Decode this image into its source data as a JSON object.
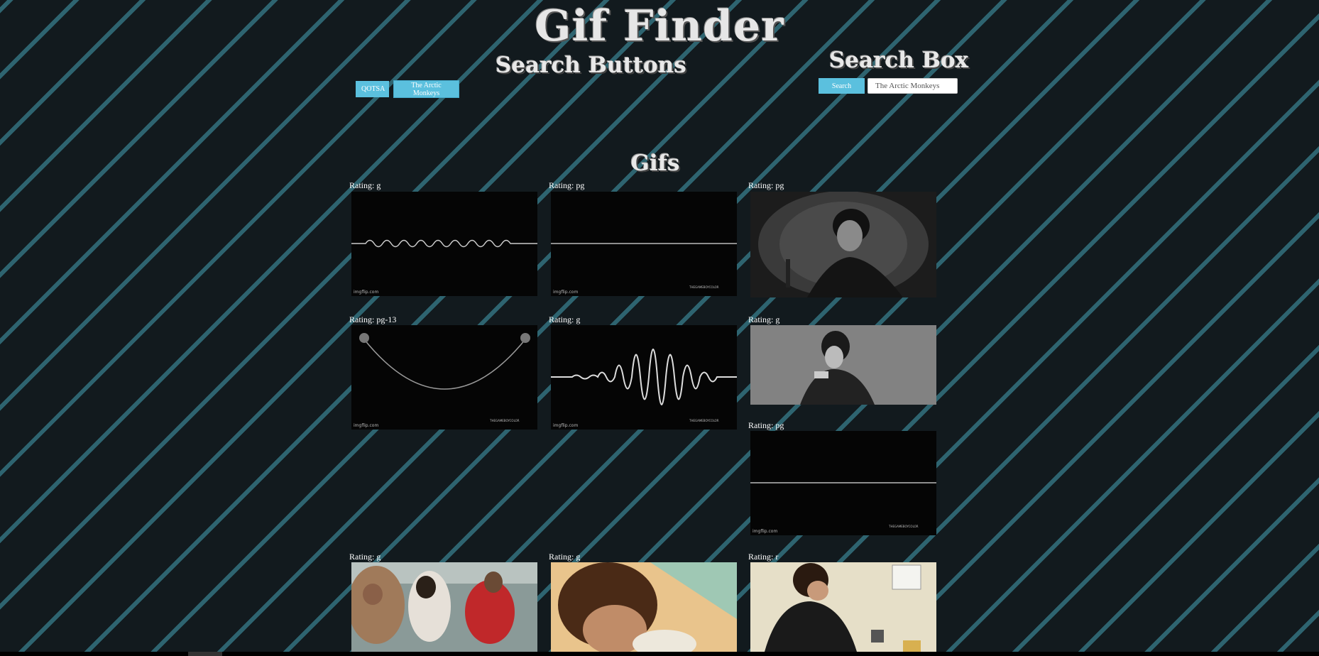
{
  "header": {
    "title": "Gif Finder"
  },
  "search_buttons": {
    "title": "Search Buttons",
    "buttons": [
      "QOTSA",
      "The Arctic Monkeys"
    ]
  },
  "search_box": {
    "title": "Search Box",
    "button_label": "Search",
    "input_value": "The Arctic Monkeys"
  },
  "gifs": {
    "title": "Gifs",
    "items": [
      {
        "rating": "Rating: g",
        "content": "sound wave line",
        "watermark": "imgflip.com"
      },
      {
        "rating": "Rating: pg",
        "content": "flat line",
        "watermark": "imgflip.com",
        "watermark2": "THEGAMEBOYCOLOR"
      },
      {
        "rating": "Rating: pg",
        "content": "singer black and white photo"
      },
      {
        "rating": "Rating: pg-13",
        "content": "rope curve",
        "watermark": "imgflip.com",
        "watermark2": "THEGAMEBOYCOLOR"
      },
      {
        "rating": "Rating: g",
        "content": "large sound wave",
        "watermark": "imgflip.com",
        "watermark2": "THEGAMEBOYCOLOR"
      },
      {
        "rating": "Rating: g",
        "content": "man pointing black and white"
      },
      {
        "rating": "Rating: pg",
        "content": "flat line",
        "watermark": "imgflip.com",
        "watermark2": "THEGAMEBOYCOLOR"
      },
      {
        "rating": "Rating: g",
        "content": "men on boat"
      },
      {
        "rating": "Rating: g",
        "content": "boy with hair"
      },
      {
        "rating": "Rating: r",
        "content": "man with guitar"
      }
    ]
  }
}
